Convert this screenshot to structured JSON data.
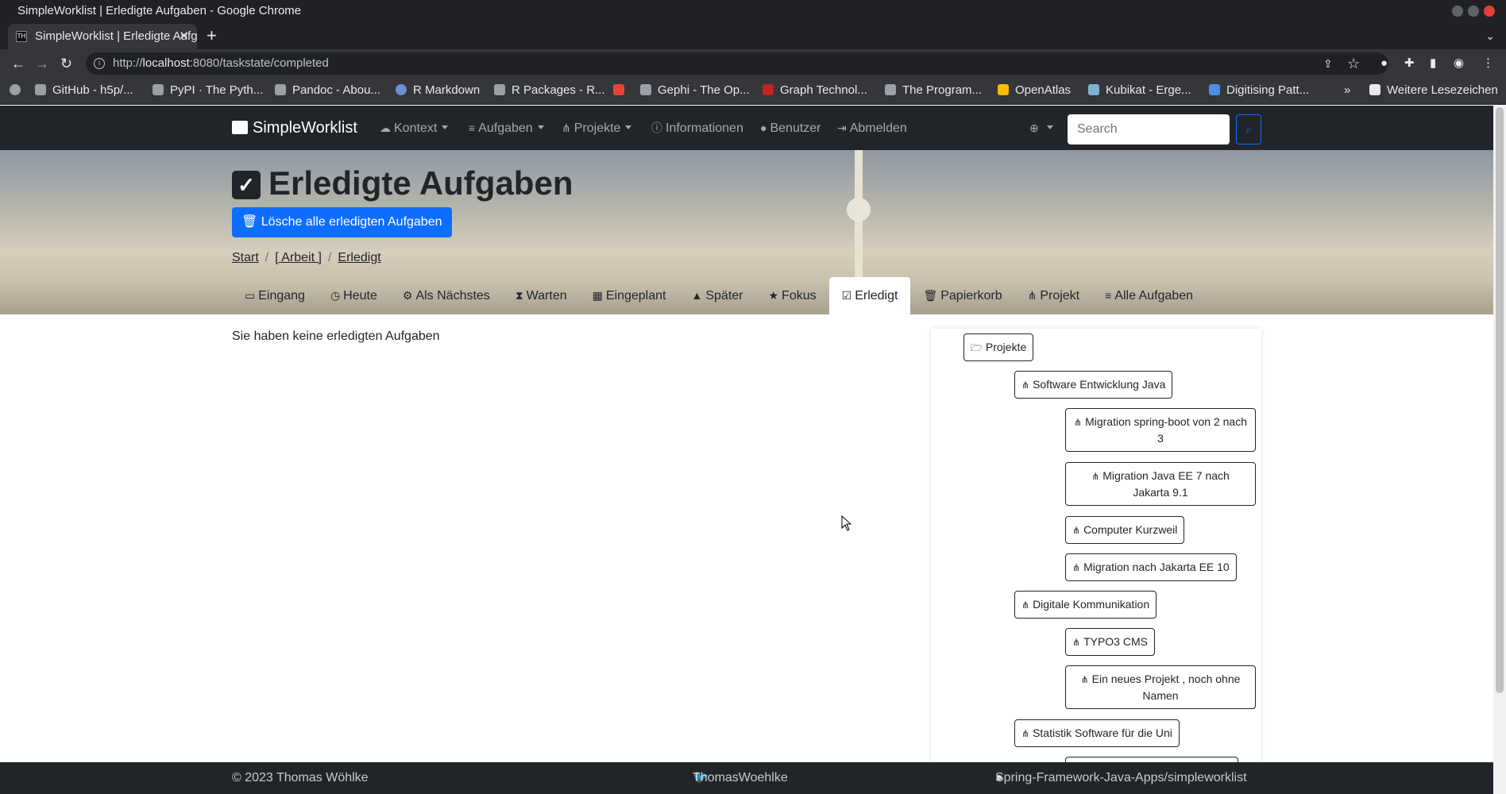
{
  "window": {
    "title": "SimpleWorklist | Erledigte Aufgaben - Google Chrome"
  },
  "browser": {
    "tab_title": "SimpleWorklist | Erledigte Aufgaben",
    "favicon_text": "TH",
    "url_scheme": "http://",
    "url_host": "localhost",
    "url_rest": ":8080/taskstate/completed",
    "bookmarks": [
      "GitHub - h5p/...",
      "PyPI · The Pyth...",
      "Pandoc - Abou...",
      "R Markdown",
      "R Packages - R...",
      "Gephi - The Op...",
      "Graph Technol...",
      "The Program...",
      "OpenAtlas",
      "Kubikat - Erge...",
      "Digitising Patt..."
    ],
    "bookmarks_overflow": "»",
    "other_bookmarks": "Weitere Lesezeichen"
  },
  "navbar": {
    "brand": "SimpleWorklist",
    "items": [
      "Kontext",
      "Aufgaben",
      "Projekte",
      "Informationen",
      "Benutzer",
      "Abmelden"
    ],
    "search_placeholder": "Search"
  },
  "hero": {
    "title": "Erledigte Aufgaben",
    "delete_button": "Lösche alle erledigten Aufgaben",
    "breadcrumb": [
      "Start",
      "[ Arbeit ]",
      "Erledigt"
    ],
    "tabs": [
      "Eingang",
      "Heute",
      "Als Nächstes",
      "Warten",
      "Eingeplant",
      "Später",
      "Fokus",
      "Erledigt",
      "Papierkorb",
      "Projekt",
      "Alle Aufgaben"
    ],
    "active_tab": "Erledigt"
  },
  "main": {
    "empty_message": "Sie haben keine erledigten Aufgaben"
  },
  "sidebar": {
    "root": "Projekte",
    "projects": [
      "Software Entwicklung Java",
      "Migration spring-boot von 2 nach 3",
      "Migration Java EE 7 nach Jakarta 9.1",
      "Computer Kurzweil",
      "Migration nach Jakarta EE 10",
      "Digitale Kommunikation",
      "TYPO3 CMS",
      "Ein neues Projekt , noch ohne Namen",
      "Statistik Software für die Uni"
    ]
  },
  "footer": {
    "copyright": "© 2023 Thomas Wöhlke",
    "twitter": "ThomasWoehlke",
    "github": "Spring-Framework-Java-Apps/simpleworklist"
  },
  "colors": {
    "primary": "#0d6efd",
    "dark": "#212529"
  }
}
